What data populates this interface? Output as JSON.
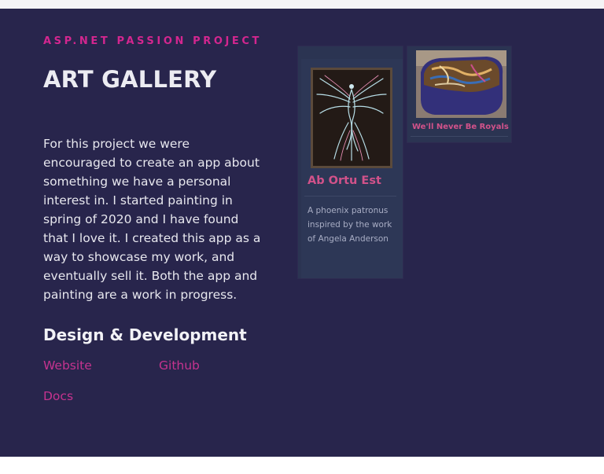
{
  "header": {
    "eyebrow": "ASP.NET PASSION PROJECT",
    "title": "ART GALLERY"
  },
  "intro": {
    "description": "For this project we were encouraged to create an app about something we have a personal interest in. I started painting in spring of 2020 and I have found that I love it. I created this app as a way to showcase my work, and eventually sell it. Both the app and painting are a work in progress."
  },
  "design_dev": {
    "heading": "Design & Development",
    "links": {
      "website": "Website",
      "github": "Github",
      "docs": "Docs"
    }
  },
  "gallery": {
    "cards": [
      {
        "title": "Ab Ortu Est",
        "text": "A phoenix patronus inspired by the work of Angela Anderson"
      },
      {
        "title": "We'll Never Be Royals"
      }
    ]
  },
  "colors": {
    "panel_bg": "#28254c",
    "accent": "#d3268f",
    "link": "#c6338f"
  }
}
